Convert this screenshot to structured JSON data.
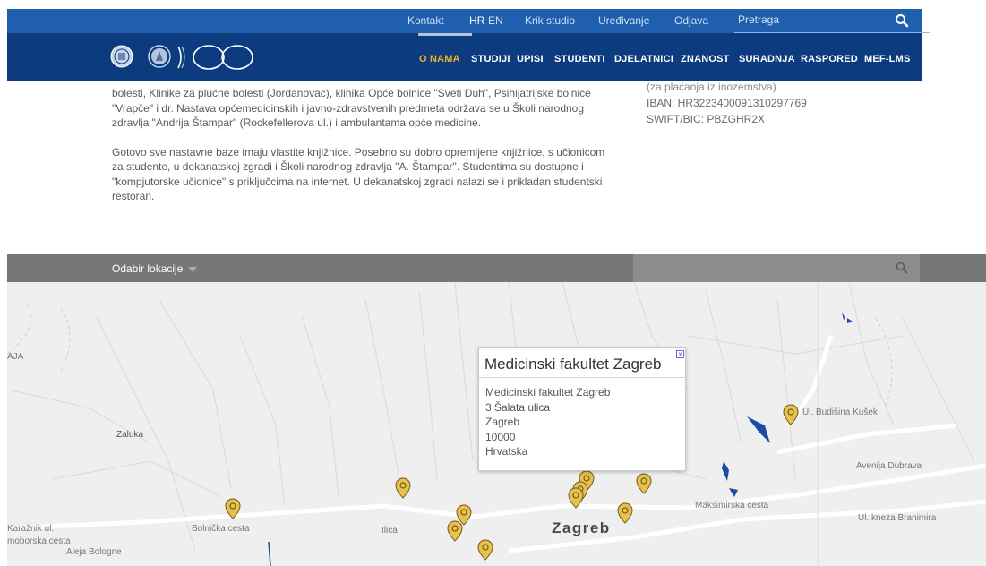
{
  "utility_bar": {
    "contact": "Kontakt",
    "lang_hr": "HR",
    "lang_en": "EN",
    "krik": "Krik studio",
    "edit": "Uređivanje",
    "logout": "Odjava",
    "search_placeholder": "Pretraga"
  },
  "nav": {
    "items": [
      "O NAMA",
      "STUDIJI",
      "UPISI",
      "STUDENTI",
      "DJELATNICI",
      "ZNANOST",
      "SURADNJA",
      "RASPORED",
      "MEF-LMS"
    ],
    "active": "O NAMA"
  },
  "content": {
    "p1_lines": [
      "bolesti, Klinike za plućne bolesti (Jordanovac), klinika Opće bolnice \"Sveti Duh\", Psihijatrijske bolnice",
      "\"Vrapče\" i dr. Nastava općemedicinskih i javno-zdravstvenih predmeta održava se u Školi narodnog",
      "zdravlja \"Andrija Štampar\" (Rockefellerova ul.) i ambulantama opće medicine."
    ],
    "p2_lines": [
      "Gotovo sve nastavne baze imaju vlastite knjižnice. Posebno su dobro opremljene knjižnice, s učionicom",
      "za studente, u dekanatskoj zgradi i Školi narodnog zdravlja \"A. Štampar\". Studentima su dostupne i",
      "\"kompjutorske učionice\" s priključcima na internet. U dekanatskoj zgradi nalazi se i prikladan studentski",
      "restoran."
    ]
  },
  "aside": {
    "cut_line": "(za plaćanja iz inozemstva)",
    "iban": "IBAN: HR3223400091310297769",
    "swift": "SWIFT/BIC: PBZGHR2X"
  },
  "location_bar": {
    "dropdown_label": "Odabir lokacije"
  },
  "map": {
    "city_label": "Zagreb",
    "labels": [
      "Zaluka",
      "AJA",
      "Ilica",
      "Maksimirska cesta",
      "Avenija Dubrava",
      "Ul. kneza Branimira",
      "Bolnička cesta",
      "Aleja Bologne",
      "Ul. Budišina Kušek",
      "Karažnik ul.",
      "moborska cesta"
    ],
    "popup": {
      "title": "Medicinski fakultet Zagreb",
      "close_label": "x",
      "lines": [
        "Medicinski fakultet Zagreb",
        "3 Šalata ulica",
        "Zagreb",
        "10000",
        "Hrvatska"
      ]
    }
  },
  "colors": {
    "utility_bar": "#1f5fae",
    "navbar": "#0c3b80",
    "accent": "#f0b323",
    "location_bar": "#777777",
    "map_bg": "#efefef",
    "pin": "#e8c04a"
  },
  "icons": [
    "search-icon",
    "university-seal-icon",
    "faculty-emblem-icon",
    "anniversary-100-logo",
    "magnifier-icon",
    "map-pin-icon",
    "close-icon",
    "caret-down-icon"
  ]
}
